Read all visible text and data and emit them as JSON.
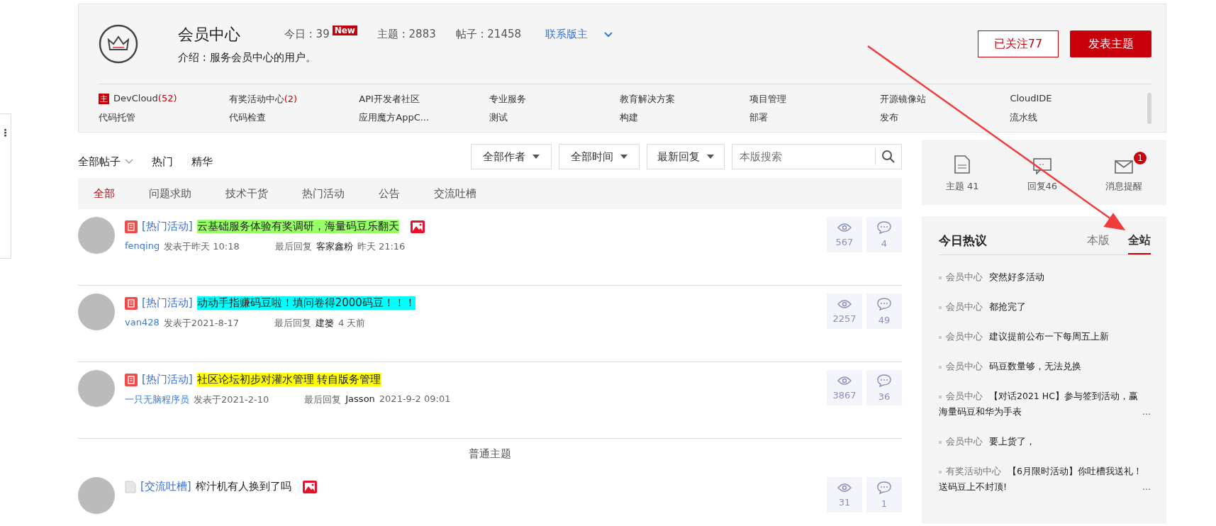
{
  "forum": {
    "name": "会员中心",
    "stats": [
      {
        "label": "今日 : 39",
        "badge": "New"
      },
      {
        "label": "主题 : 2883"
      },
      {
        "label": "帖子 : 21458"
      }
    ],
    "contact": "联系版主",
    "intro": "介绍 : 服务会员中心的用户。",
    "follow_button": "已关注77",
    "post_button": "发表主题",
    "links": [
      {
        "label": "DevCloud",
        "count": "(52)",
        "badge": "主"
      },
      {
        "label": "有奖活动中心",
        "count": "(2)"
      },
      {
        "label": "API开发者社区"
      },
      {
        "label": "专业服务"
      },
      {
        "label": "教育解决方案"
      },
      {
        "label": "项目管理"
      },
      {
        "label": "开源镜像站"
      },
      {
        "label": "CloudIDE"
      },
      {
        "label": "代码托管"
      },
      {
        "label": "代码检查"
      },
      {
        "label": "应用魔方AppC..."
      },
      {
        "label": "测试"
      },
      {
        "label": "构建"
      },
      {
        "label": "部署"
      },
      {
        "label": "发布"
      },
      {
        "label": "流水线"
      }
    ]
  },
  "filters": {
    "views": [
      {
        "label": "全部帖子",
        "dropdown": true
      },
      {
        "label": "热门",
        "dropdown": false
      },
      {
        "label": "精华",
        "dropdown": false
      }
    ],
    "dropdowns": [
      "全部作者",
      "全部时间",
      "最新回复"
    ],
    "search": {
      "placeholder": "本版搜索"
    }
  },
  "categories": [
    {
      "label": "全部",
      "selected": true
    },
    {
      "label": "问题求助",
      "selected": false
    },
    {
      "label": "技术干货",
      "selected": false
    },
    {
      "label": "热门活动",
      "selected": false
    },
    {
      "label": "公告",
      "selected": false
    },
    {
      "label": "交流吐槽",
      "selected": false
    }
  ],
  "pinned_posts": [
    {
      "kind": "pinned",
      "tag": "[热门活动]",
      "title": "云基础服务体验有奖调研，海量码豆乐翻天",
      "color": "#99ff66",
      "has_image": true,
      "author": "fenqing",
      "posted": "发表于昨天 10:18",
      "last_reply_label": "最后回复",
      "last_reply_user": "客家鑫粉",
      "last_reply_time": "昨天 21:16",
      "views": "567",
      "replies": "4"
    },
    {
      "kind": "pinned",
      "tag": "[热门活动]",
      "title": "动动手指赚码豆啦！填问卷得2000码豆！！！",
      "color": "#00ffff",
      "has_image": false,
      "author": "van428",
      "posted": "发表于2021-8-17",
      "last_reply_label": "最后回复",
      "last_reply_user": "建篓",
      "last_reply_time": "4 天前",
      "views": "2257",
      "replies": "49"
    },
    {
      "kind": "pinned",
      "tag": "[热门活动]",
      "title": "社区论坛初步对灌水管理 转自版务管理",
      "color": "#ffff00",
      "has_image": false,
      "author": "一只无脑程序员",
      "posted": "发表于2021-2-10",
      "last_reply_label": "最后回复",
      "last_reply_user": "Jasson",
      "last_reply_time": "2021-9-2 09:01",
      "views": "3867",
      "replies": "36"
    }
  ],
  "section_label": "普通主题",
  "normal_posts": [
    {
      "kind": "normal",
      "tag": "[交流吐槽]",
      "title": "榨汁机有人换到了吗",
      "has_image": true,
      "views": "31",
      "replies": "1"
    }
  ],
  "user_stats": [
    {
      "kind": "topic",
      "label": "主题 41"
    },
    {
      "kind": "reply",
      "label": "回复46"
    },
    {
      "kind": "message",
      "label": "消息提醒",
      "badge": "1"
    }
  ],
  "hot": {
    "title": "今日热议",
    "tabs": [
      {
        "label": "本版",
        "selected": false
      },
      {
        "label": "全站",
        "selected": true
      }
    ],
    "items": [
      {
        "forum": "会员中心",
        "title": "突然好多活动"
      },
      {
        "forum": "会员中心",
        "title": "都抢完了"
      },
      {
        "forum": "会员中心",
        "title": "建议提前公布一下每周五上新"
      },
      {
        "forum": "会员中心",
        "title": "码豆数量够，无法兑换"
      },
      {
        "forum": "会员中心",
        "title": "【对话2021 HC】参与签到活动，赢海量码豆和华为手表",
        "more": "..."
      },
      {
        "forum": "会员中心",
        "title": "要上货了，"
      },
      {
        "forum": "有奖活动中心",
        "title": "【6月限时活动】你吐槽我送礼！送码豆上不封顶!",
        "more": "..."
      }
    ]
  },
  "side_tab": {
    "icon": "⋮"
  }
}
